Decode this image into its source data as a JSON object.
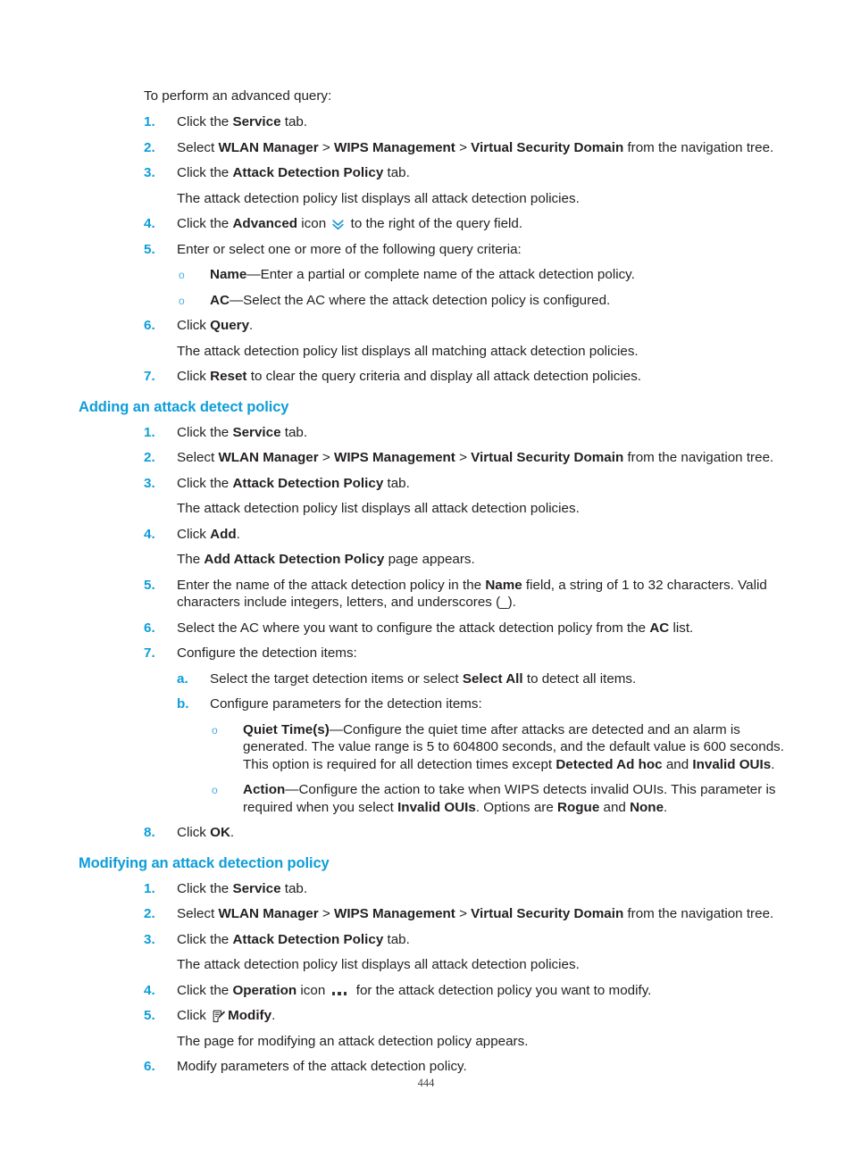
{
  "page": {
    "number": "444",
    "heading_color": "#0e9dd9",
    "body_color": "#231f20"
  },
  "intro": {
    "lead": "To perform an advanced query:"
  },
  "advanced_query": {
    "steps": [
      {
        "marker": "1.",
        "text_pre": "Click the ",
        "bold": "Service",
        "text_post": " tab."
      },
      {
        "marker": "2.",
        "text": "Select WLAN Manager > WIPS Management > Virtual Security Domain from the navigation tree."
      },
      {
        "marker": "3.",
        "text": "Click the Attack Detection Policy tab."
      },
      {
        "marker": "4.",
        "text": "Click the Advanced icon to the right of the query field."
      },
      {
        "marker": "5.",
        "text": "Enter or select one or more of the following query criteria:"
      },
      {
        "marker": "6.",
        "text": "Click Query."
      },
      {
        "marker": "7.",
        "text": "Click Reset to clear the query criteria and display all attack detection policies."
      }
    ],
    "step1_pre": "Click the ",
    "step1_bold": "Service",
    "step1_post": " tab.",
    "step2_pre": "Select ",
    "step2_b1": "WLAN Manager",
    "step2_sep1": " > ",
    "step2_b2": "WIPS Management",
    "step2_sep2": " > ",
    "step2_b3": "Virtual Security Domain",
    "step2_post": " from the navigation tree.",
    "step3_pre": "Click the ",
    "step3_bold": "Attack Detection Policy",
    "step3_post": " tab.",
    "step3_result": "The attack detection policy list displays all attack detection policies.",
    "step4_pre": "Click the ",
    "step4_bold": "Advanced",
    "step4_mid": " icon ",
    "step4_post": " to the right of the query field.",
    "step5_text": "Enter or select one or more of the following query criteria:",
    "criteria": [
      {
        "bullet": "o",
        "bold": "Name",
        "text": "—Enter a partial or complete name of the attack detection policy."
      },
      {
        "bullet": "o",
        "bold": "AC",
        "text": "—Select the AC where the attack detection policy is configured."
      }
    ],
    "step6_pre": "Click ",
    "step6_bold": "Query",
    "step6_post": ".",
    "step6_result": "The attack detection policy list displays all matching attack detection policies.",
    "step7_pre": "Click ",
    "step7_bold": "Reset",
    "step7_post": " to clear the query criteria and display all attack detection policies."
  },
  "adding": {
    "heading": "Adding an attack detect policy",
    "step1_pre": "Click the ",
    "step1_bold": "Service",
    "step1_post": " tab.",
    "step2_pre": "Select ",
    "step2_b1": "WLAN Manager",
    "step2_sep1": " > ",
    "step2_b2": "WIPS Management",
    "step2_sep2": " > ",
    "step2_b3": "Virtual Security Domain",
    "step2_post": " from the navigation tree.",
    "step3_pre": "Click the ",
    "step3_bold": "Attack Detection Policy",
    "step3_post": " tab.",
    "step3_result": "The attack detection policy list displays all attack detection policies.",
    "step4_pre": "Click ",
    "step4_bold": "Add",
    "step4_post": ".",
    "step4_result_pre": "The ",
    "step4_result_bold": "Add Attack Detection Policy",
    "step4_result_post": " page appears.",
    "step5_pre": "Enter the name of the attack detection policy in the ",
    "step5_bold": "Name",
    "step5_post": " field, a string of 1 to 32 characters. Valid characters include integers, letters, and underscores (_).",
    "step6_pre": "Select the AC where you want to configure the attack detection policy from the ",
    "step6_bold": "AC",
    "step6_post": " list.",
    "step7_text": "Configure the detection items:",
    "sub_a_marker": "a.",
    "sub_a_pre": "Select the target detection items or select ",
    "sub_a_bold": "Select All",
    "sub_a_post": " to detect all items.",
    "sub_b_marker": "b.",
    "sub_b_text": "Configure parameters for the detection items:",
    "quiet_bullet": "o",
    "quiet_bold": "Quiet Time(s)",
    "quiet_t1": "—Configure the quiet time after attacks are detected and an alarm is generated. The value range is 5 to 604800 seconds, and the default value is 600 seconds. This option is required for all detection times except ",
    "quiet_b2": "Detected Ad hoc",
    "quiet_t2": " and ",
    "quiet_b3": "Invalid OUIs",
    "quiet_t3": ".",
    "action_bullet": "o",
    "action_bold": "Action",
    "action_t1": "—Configure the action to take when WIPS detects invalid OUIs. This parameter is required when you select ",
    "action_b2": "Invalid OUIs",
    "action_t2": ". Options are ",
    "action_b3": "Rogue",
    "action_t3": " and ",
    "action_b4": "None",
    "action_t4": ".",
    "step8_pre": "Click ",
    "step8_bold": "OK",
    "step8_post": "."
  },
  "modifying": {
    "heading": "Modifying an attack detection policy",
    "step1_pre": "Click the ",
    "step1_bold": "Service",
    "step1_post": " tab.",
    "step2_pre": "Select ",
    "step2_b1": "WLAN Manager",
    "step2_sep1": " > ",
    "step2_b2": "WIPS Management",
    "step2_sep2": " > ",
    "step2_b3": "Virtual Security Domain",
    "step2_post": " from the navigation tree.",
    "step3_pre": "Click the ",
    "step3_bold": "Attack Detection Policy",
    "step3_post": " tab.",
    "step3_result": "The attack detection policy list displays all attack detection policies.",
    "step4_pre": "Click the ",
    "step4_bold": "Operation",
    "step4_mid": " icon ",
    "step4_post": " for the attack detection policy you want to modify.",
    "step5_pre": "Click ",
    "step5_bold": "Modify",
    "step5_post": ".",
    "step5_result": "The page for modifying an attack detection policy appears.",
    "step6_text": "Modify parameters of the attack detection policy."
  },
  "markers": {
    "n1": "1.",
    "n2": "2.",
    "n3": "3.",
    "n4": "4.",
    "n5": "5.",
    "n6": "6.",
    "n7": "7.",
    "n8": "8.",
    "obullet": "o",
    "a": "a.",
    "b": "b."
  },
  "icons": {
    "advanced": "double-chevron-down-icon",
    "operation": "ellipsis-icon",
    "modify": "edit-document-icon"
  }
}
